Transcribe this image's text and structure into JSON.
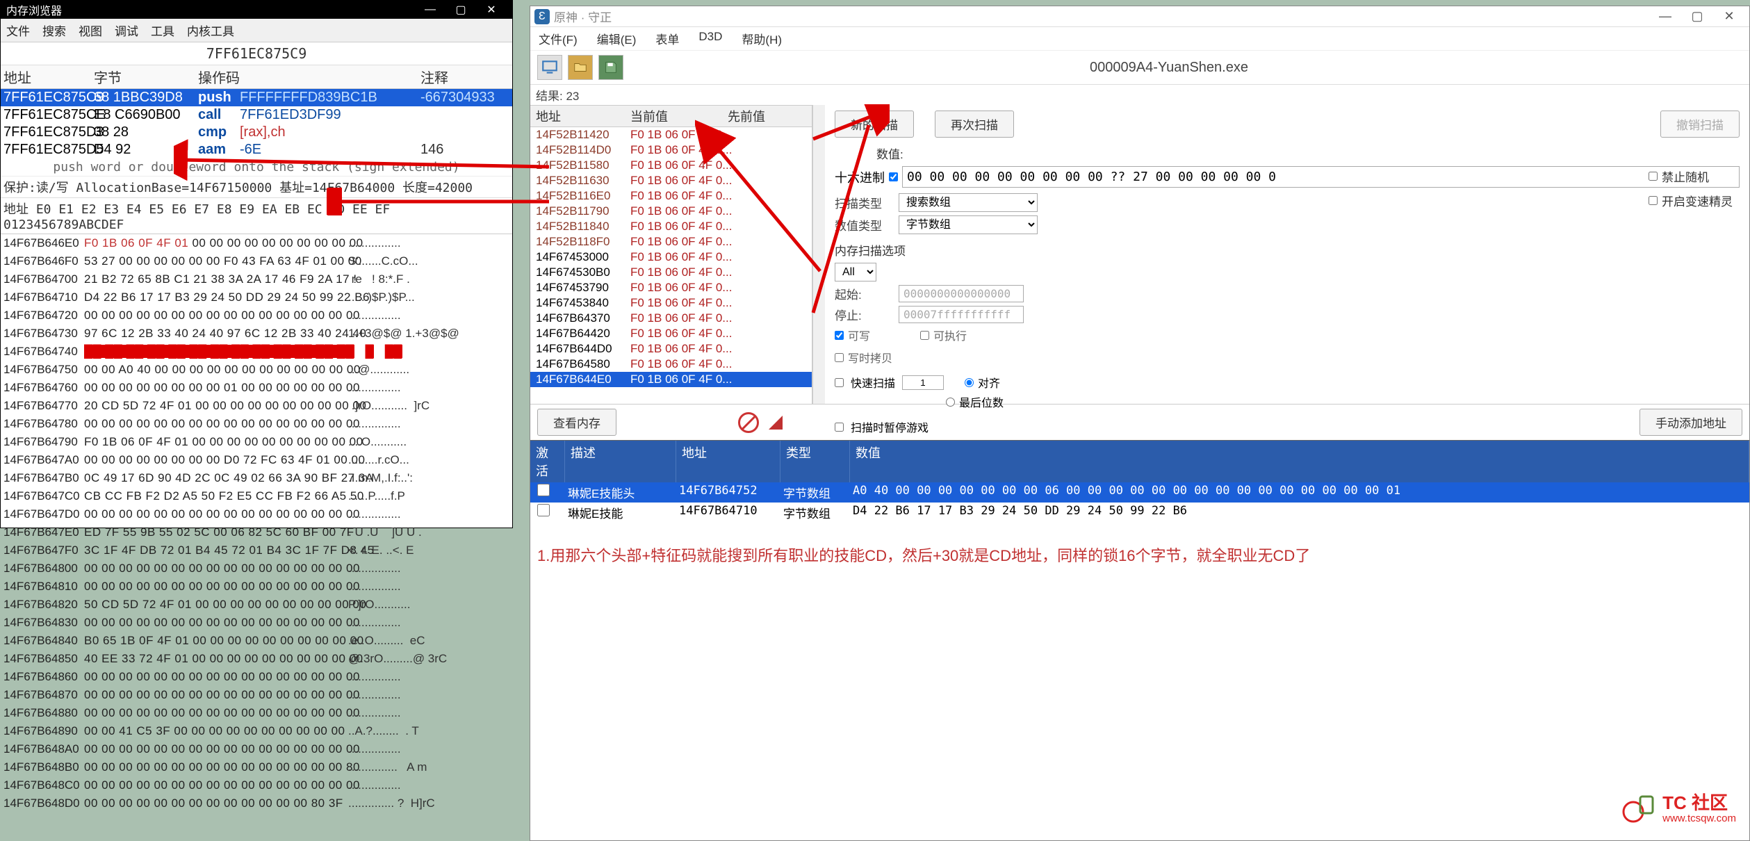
{
  "left": {
    "title": "内存浏览器",
    "menu": [
      "文件",
      "搜索",
      "视图",
      "调试",
      "工具",
      "内核工具"
    ],
    "currentAddr": "7FF61EC875C9",
    "disHead": {
      "addr": "地址",
      "bytes": "字节",
      "op": "操作码",
      "cmt": "注释"
    },
    "disRows": [
      {
        "addr": "7FF61EC875C9",
        "bytes": "68 1BBC39D8",
        "op": "push",
        "arg": "FFFFFFFFD839BC1B",
        "cmt": "-667304933",
        "sel": true
      },
      {
        "addr": "7FF61EC875CE",
        "bytes": "E8 C6690B00",
        "op": "call",
        "arg": "7FF61ED3DF99"
      },
      {
        "addr": "7FF61EC875D3",
        "bytes": "38 28",
        "op": "cmp",
        "arg": "[rax],ch",
        "red": true
      },
      {
        "addr": "7FF61EC875D5",
        "bytes": "D4 92",
        "op": "aam",
        "arg": "-6E",
        "cmt": "146"
      }
    ],
    "hint": "push word or doubleword onto the stack (sign extended)",
    "prot": "保护:读/写  AllocationBase=14F67150000  基址=14F67B64000 长度=42000",
    "hexHead": "地址        E0 E1 E2 E3 E4 E5 E6 E7 E8 E9 EA EB EC ED EE EF  0123456789ABCDEF",
    "hex": [
      {
        "a": "14F67B646E0",
        "b": true,
        "bytes": "F0 1B 06 0F 4F 01 00 00 00 00 00 00 00 00 00 00",
        "r": "F0 1B 06 0F 4F 01",
        "asc": "................"
      },
      {
        "a": "14F67B646F0",
        "bytes": "53 27 00 00 00 00 00 00 F0 43 FA 63 4F 01 00 00",
        "asc": "S'.......C.cO..."
      },
      {
        "a": "14F67B64700",
        "bytes": "21 B2 72 65 8B C1 21 38 3A 2A 17 46 F9 2A 17 !",
        "asc": " re   ! 8:*.F ."
      },
      {
        "a": "14F67B64710",
        "bytes": "D4 22 B6 17 17 B3 29 24 50 DD 29 24 50 99 22 B6",
        "asc": "......)$P.)$P..."
      },
      {
        "a": "14F67B64720",
        "bytes": "00 00 00 00 00 00 00 00 00 00 00 00 00 00 00 00",
        "asc": "................"
      },
      {
        "a": "14F67B64730",
        "bytes": "97 6C 12 2B 33 40 24 40 97 6C 12 2B 33 40 24 40",
        "asc": ".l.+3@$@.l.+3@$@",
        "asc2": "1.+3@$@ 1.+3@$@"
      },
      {
        "a": "14F67B64740",
        "bytes": "",
        "red": true,
        "asc": ""
      },
      {
        "a": "14F67B64750",
        "bytes": "00 00 A0 40 00 00 00 00 00 00 00 00 00 00 00 00",
        "asc": "...@............"
      },
      {
        "a": "14F67B64760",
        "bytes": "00 00 00 00 00 00 00 00 01 00 00 00 00 00 00 00",
        "asc": "................"
      },
      {
        "a": "14F67B64770",
        "bytes": "20 CD 5D 72 4F 01 00 00 00 00 00 00 00 00 00 00",
        "asc": " .]rO...........  ]rC"
      },
      {
        "a": "14F67B64780",
        "bytes": "00 00 00 00 00 00 00 00 00 00 00 00 00 00 00 00",
        "asc": "................"
      },
      {
        "a": "14F67B64790",
        "bytes": "F0 1B 06 0F 4F 01 00 00 00 00 00 00 00 00 00 00",
        "asc": "....O..........."
      },
      {
        "a": "14F67B647A0",
        "bytes": "00 00 00 00 00 00 00 00 D0 72 FC 63 4F 01 00 00",
        "asc": ".........r.cO..."
      },
      {
        "a": "14F67B647B0",
        "bytes": "0C 49 17 6D 90 4D 2C 0C 49 02 66 3A 90 BF 27 3A",
        "asc": ".I.m.M,.I.f:..':"
      },
      {
        "a": "14F67B647C0",
        "bytes": "CB CC FB F2 D2 A5 50 F2 E5 CC FB F2 66 A5 50",
        "asc": "......P.....f.P"
      },
      {
        "a": "14F67B647D0",
        "bytes": "00 00 00 00 00 00 00 00 00 00 00 00 00 00 00 00",
        "asc": "................"
      },
      {
        "a": "14F67B647E0",
        "bytes": "ED 7F 55 9B 55 02 5C 00 06 82 5C 60 BF 00 7F",
        "asc": ". U .U    ]U U ."
      },
      {
        "a": "14F67B647F0",
        "bytes": "3C 1F 4F DB 72 01 B4 45 72 01 B4 3C 1F 7F D8 45",
        "asc": "<. r. E. ..<. E"
      },
      {
        "a": "14F67B64800",
        "bytes": "00 00 00 00 00 00 00 00 00 00 00 00 00 00 00 00",
        "asc": "................"
      },
      {
        "a": "14F67B64810",
        "bytes": "00 00 00 00 00 00 00 00 00 00 00 00 00 00 00 00",
        "asc": "................"
      },
      {
        "a": "14F67B64820",
        "bytes": "50 CD 5D 72 4F 01 00 00 00 00 00 00 00 00 00 00",
        "asc": "P.]rO..........."
      },
      {
        "a": "14F67B64830",
        "bytes": "00 00 00 00 00 00 00 00 00 00 00 00 00 00 00 00",
        "asc": "................"
      },
      {
        "a": "14F67B64840",
        "bytes": "B0 65 1B 0F 4F 01 00 00 00 00 00 00 00 00 00 00",
        "asc": ".e..O.........  eC"
      },
      {
        "a": "14F67B64850",
        "bytes": "40 EE 33 72 4F 01 00 00 00 00 00 00 00 00 00 00",
        "asc": "@.3rO.........@ 3rC"
      },
      {
        "a": "14F67B64860",
        "bytes": "00 00 00 00 00 00 00 00 00 00 00 00 00 00 00 00",
        "asc": "................"
      },
      {
        "a": "14F67B64870",
        "bytes": "00 00 00 00 00 00 00 00 00 00 00 00 00 00 00 00",
        "asc": "................"
      },
      {
        "a": "14F67B64880",
        "bytes": "00 00 00 00 00 00 00 00 00 00 00 00 00 00 00 00",
        "asc": "................"
      },
      {
        "a": "14F67B64890",
        "bytes": "00 00 41 C5 3F 00 00 00 00 00 00 00 00 00 00",
        "asc": "..A.?........  . T"
      },
      {
        "a": "14F67B648A0",
        "bytes": "00 00 00 00 00 00 00 00 00 00 00 00 00 00 00 00",
        "asc": "................"
      },
      {
        "a": "14F67B648B0",
        "bytes": "00 00 00 00 00 00 00 00 00 00 00 00 00 00 00 80",
        "asc": "...............   A m"
      },
      {
        "a": "14F67B648C0",
        "bytes": "00 00 00 00 00 00 00 00 00 00 00 00 00 00 00 00",
        "asc": "................"
      },
      {
        "a": "14F67B648D0",
        "bytes": "00 00 00 00 00 00 00 00 00 00 00 00 00 80 3F",
        "asc": ".............. ?  H]rC"
      }
    ]
  },
  "right": {
    "title": "原神 · 守正",
    "menu": [
      "文件(F)",
      "编辑(E)",
      "表单",
      "D3D",
      "帮助(H)"
    ],
    "process": "000009A4-YuanShen.exe",
    "resultCount": "结果: 23",
    "scanHead": {
      "addr": "地址",
      "cur": "当前值",
      "prev": "先前值"
    },
    "scanRows": [
      {
        "a": "14F52B11420",
        "v": "F0 1B 06 0F 4F 0...",
        "c": "brown"
      },
      {
        "a": "14F52B114D0",
        "v": "F0 1B 06 0F 4F 0...",
        "c": "brown"
      },
      {
        "a": "14F52B11580",
        "v": "F0 1B 06 0F 4F 0...",
        "c": "brown"
      },
      {
        "a": "14F52B11630",
        "v": "F0 1B 06 0F 4F 0...",
        "c": "brown"
      },
      {
        "a": "14F52B116E0",
        "v": "F0 1B 06 0F 4F 0...",
        "c": "brown"
      },
      {
        "a": "14F52B11790",
        "v": "F0 1B 06 0F 4F 0...",
        "c": "brown"
      },
      {
        "a": "14F52B11840",
        "v": "F0 1B 06 0F 4F 0...",
        "c": "brown"
      },
      {
        "a": "14F52B118F0",
        "v": "F0 1B 06 0F 4F 0...",
        "c": "brown"
      },
      {
        "a": "14F67453000",
        "v": "F0 1B 06 0F 4F 0...",
        "c": "black"
      },
      {
        "a": "14F674530B0",
        "v": "F0 1B 06 0F 4F 0...",
        "c": "black"
      },
      {
        "a": "14F67453790",
        "v": "F0 1B 06 0F 4F 0...",
        "c": "black"
      },
      {
        "a": "14F67453840",
        "v": "F0 1B 06 0F 4F 0...",
        "c": "black"
      },
      {
        "a": "14F67B64370",
        "v": "F0 1B 06 0F 4F 0...",
        "c": "black"
      },
      {
        "a": "14F67B64420",
        "v": "F0 1B 06 0F 4F 0...",
        "c": "black"
      },
      {
        "a": "14F67B644D0",
        "v": "F0 1B 06 0F 4F 0...",
        "c": "black"
      },
      {
        "a": "14F67B64580",
        "v": "F0 1B 06 0F 4F 0...",
        "c": "black"
      },
      {
        "a": "14F67B644E0",
        "v": "F0 1B 06 0F 4F 0...",
        "c": "black",
        "sel": true
      }
    ],
    "btnNew": "新的扫描",
    "btnNext": "再次扫描",
    "btnUndo": "撤销扫描",
    "valLabel": "数值:",
    "hexLabel": "十六进制",
    "hexInput": "00 00 00 00 00 00 00 00 00 ?? 27 00 00 00 00 00 0",
    "scanTypeLabel": "扫描类型",
    "scanTypeVal": "搜索数组",
    "valTypeLabel": "数值类型",
    "valTypeVal": "字节数组",
    "memOptsLabel": "内存扫描选项",
    "startLabel": "起始:",
    "startVal": "0000000000000000",
    "stopLabel": "停止:",
    "stopVal": "00007fffffffffff",
    "writable": "可写",
    "executable": "可执行",
    "cow": "写时拷贝",
    "fastLabel": "快速扫描",
    "fastVal": "1",
    "alignLabel": "对齐",
    "lastDigit": "最后位数",
    "pauseLabel": "扫描时暂停游戏",
    "opt1": "禁止随机",
    "opt2": "开启变速精灵",
    "viewMem": "查看内存",
    "manualAdd": "手动添加地址",
    "alHead": {
      "act": "激活",
      "desc": "描述",
      "addr": "地址",
      "type": "类型",
      "val": "数值"
    },
    "alRows": [
      {
        "desc": "琳妮E技能头",
        "addr": "14F67B64752",
        "type": "字节数组",
        "val": "A0 40 00 00 00 00 00 00 00 06 00 00 00 00 00 00 00 00 00 00 00 00 00 00 00 01",
        "sel": true
      },
      {
        "desc": "琳妮E技能",
        "addr": "14F67B64710",
        "type": "字节数组",
        "val": "D4 22 B6 17 17 B3 29 24 50 DD 29 24 50 99 22 B6"
      }
    ],
    "note": "1.用那六个头部+特征码就能搜到所有职业的技能CD，然后+30就是CD地址，同样的锁16个字节，就全职业无CD了"
  },
  "watermark": {
    "t1": "TC 社区",
    "t2": "www.tcsqw.com"
  }
}
